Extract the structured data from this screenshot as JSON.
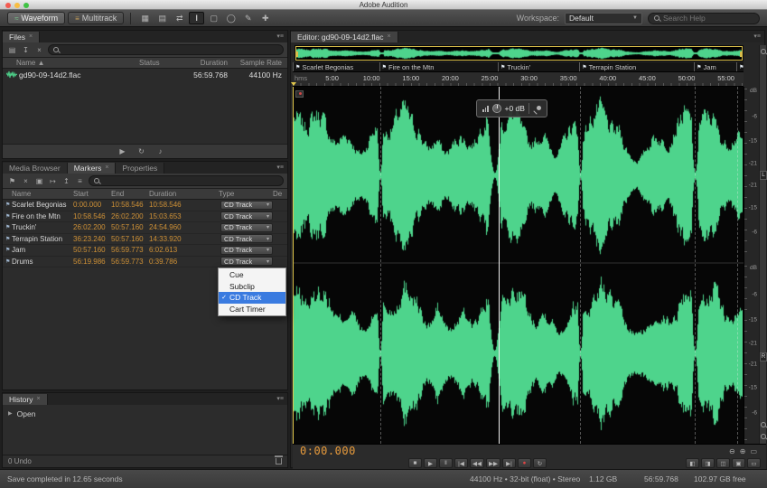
{
  "window": {
    "title": "Adobe Audition"
  },
  "toolbar": {
    "waveform": "Waveform",
    "multitrack": "Multitrack",
    "workspace_label": "Workspace:",
    "workspace_value": "Default",
    "search_placeholder": "Search Help",
    "tools": [
      {
        "name": "spectral-frequency-display-button",
        "glyph": "▦"
      },
      {
        "name": "spectral-pitch-display-button",
        "glyph": "▤"
      },
      {
        "name": "move-tool",
        "glyph": "⇄"
      },
      {
        "name": "time-selection-tool",
        "glyph": "I",
        "active": true
      },
      {
        "name": "marquee-selection-tool",
        "glyph": "▢"
      },
      {
        "name": "lasso-selection-tool",
        "glyph": "◯"
      },
      {
        "name": "paintbrush-selection-tool",
        "glyph": "✎"
      },
      {
        "name": "spot-healing-brush-tool",
        "glyph": "✚"
      }
    ]
  },
  "files": {
    "tab": "Files",
    "toolbar": [
      {
        "name": "open-file-button",
        "glyph": "▤"
      },
      {
        "name": "import-file-button",
        "glyph": "↧"
      },
      {
        "name": "close-file-button",
        "glyph": "×"
      }
    ],
    "columns": {
      "name": "Name",
      "status": "Status",
      "duration": "Duration",
      "sample_rate": "Sample Rate"
    },
    "file": {
      "name": "gd90-09-14d2.flac",
      "status": "",
      "duration": "56:59.768",
      "sample_rate": "44100 Hz"
    },
    "preview_buttons": [
      {
        "name": "play-preview-button",
        "glyph": "▶"
      },
      {
        "name": "loop-preview-button",
        "glyph": "↻"
      },
      {
        "name": "auto-play-button",
        "glyph": "♪"
      }
    ]
  },
  "markers": {
    "tabs": {
      "media_browser": "Media Browser",
      "markers": "Markers",
      "properties": "Properties"
    },
    "toolbar": [
      {
        "name": "add-cue-marker-button",
        "glyph": "⚑"
      },
      {
        "name": "delete-marker-button",
        "glyph": "×"
      },
      {
        "name": "merge-markers-button",
        "glyph": "▣"
      },
      {
        "name": "range-marker-button",
        "glyph": "↦"
      },
      {
        "name": "export-markers-button",
        "glyph": "↥"
      },
      {
        "name": "marker-list-button",
        "glyph": "≡"
      }
    ],
    "columns": {
      "name": "Name",
      "start": "Start",
      "end": "End",
      "duration": "Duration",
      "type": "Type",
      "description": "De"
    },
    "rows": [
      {
        "name": "Scarlet Begonias",
        "start": "0:00.000",
        "end": "10:58.546",
        "duration": "10:58.546",
        "type": "CD Track"
      },
      {
        "name": "Fire on the Mtn",
        "start": "10:58.546",
        "end": "26:02.200",
        "duration": "15:03.653",
        "type": "CD Track"
      },
      {
        "name": "Truckin'",
        "start": "26:02.200",
        "end": "50:57.160",
        "duration": "24:54.960",
        "type": "CD Track"
      },
      {
        "name": "Terrapin Station",
        "start": "36:23.240",
        "end": "50:57.160",
        "duration": "14:33.920",
        "type": "CD Track"
      },
      {
        "name": "Jam",
        "start": "50:57.160",
        "end": "56:59.773",
        "duration": "6:02.613",
        "type": "CD Track"
      },
      {
        "name": "Drums",
        "start": "56:19.986",
        "end": "56:59.773",
        "duration": "0:39.786",
        "type": "CD Track"
      }
    ],
    "type_menu": {
      "items": [
        "Cue",
        "Subclip",
        "CD Track",
        "Cart Timer"
      ],
      "selected": "CD Track"
    }
  },
  "history": {
    "tab": "History",
    "item": "Open",
    "undo": "0 Undo"
  },
  "statusbar": {
    "message": "Save completed in 12.65 seconds",
    "format": "44100 Hz • 32-bit (float) • Stereo",
    "file_size": "1.12 GB",
    "duration": "56:59.768",
    "free_space": "102.97 GB free"
  },
  "editor": {
    "tab": "Editor: gd90-09-14d2.flac",
    "ruler_unit": "hms",
    "time_ticks": [
      "5:00",
      "10:00",
      "15:00",
      "20:00",
      "25:00",
      "30:00",
      "35:00",
      "40:00",
      "45:00",
      "50:00",
      "55:00"
    ],
    "track_markers": [
      {
        "name": "Scarlet Begonias",
        "pos": 0
      },
      {
        "name": "Fire on the Mtn",
        "pos": 0.1924
      },
      {
        "name": "Truckin'",
        "pos": 0.4567,
        "selected": true
      },
      {
        "name": "Terrapin Station",
        "pos": 0.6383
      },
      {
        "name": "Jam",
        "pos": 0.8937
      },
      {
        "name": "Drums",
        "pos": 0.9883
      }
    ],
    "hud_gain": "+0 dB",
    "db_unit": "dB",
    "db_ticks": [
      "-6",
      "-15",
      "-21"
    ],
    "channels": [
      "L",
      "R"
    ],
    "time_display": "0:00.000",
    "transport": [
      {
        "name": "stop-button",
        "glyph": "■"
      },
      {
        "name": "play-button",
        "glyph": "▶"
      },
      {
        "name": "pause-button",
        "glyph": "‖"
      },
      {
        "name": "move-cti-to-previous-button",
        "glyph": "|◀"
      },
      {
        "name": "rewind-button",
        "glyph": "◀◀"
      },
      {
        "name": "fast-forward-button",
        "glyph": "▶▶"
      },
      {
        "name": "move-cti-to-next-button",
        "glyph": "▶|"
      },
      {
        "name": "record-button",
        "glyph": "●",
        "record": true
      },
      {
        "name": "loop-playback-button",
        "glyph": "↻"
      }
    ],
    "zoom_controls": [
      {
        "name": "zoom-in-horizontal-button",
        "glyph": "◧"
      },
      {
        "name": "zoom-out-horizontal-button",
        "glyph": "◨"
      },
      {
        "name": "zoom-in-vertical-button",
        "glyph": "◫"
      },
      {
        "name": "zoom-to-selection-button",
        "glyph": "▣"
      },
      {
        "name": "zoom-full-button",
        "glyph": "▭"
      }
    ]
  }
}
